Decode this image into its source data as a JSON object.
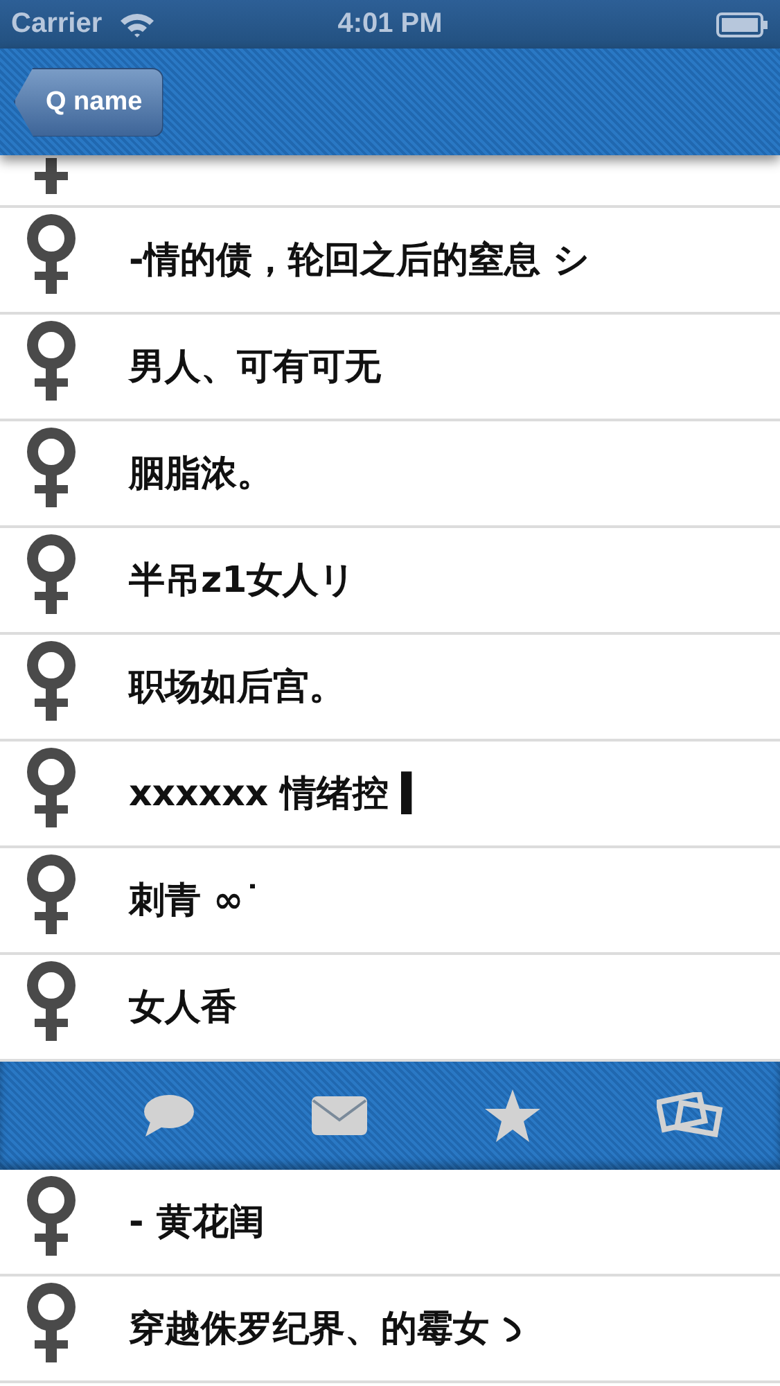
{
  "status_bar": {
    "carrier": "Carrier",
    "time": "4:01 PM"
  },
  "nav_bar": {
    "back_button": "Q name"
  },
  "list_top": [
    {
      "name": "-情的债，轮回之后的窒息 シ"
    },
    {
      "name": "男人、可有可无"
    },
    {
      "name": "胭脂浓。"
    },
    {
      "name": "半吊z1女人リ"
    },
    {
      "name": "职场如后宫。"
    },
    {
      "name": "xxxxxx 情绪控 ▍"
    },
    {
      "name": "刺青 ∞˙"
    },
    {
      "name": "女人香"
    }
  ],
  "tab_bar": {
    "tabs": [
      {
        "kind": "chat"
      },
      {
        "kind": "mail"
      },
      {
        "kind": "star"
      },
      {
        "kind": "photos"
      }
    ]
  },
  "list_bottom": [
    {
      "name": "- 黄花闺",
      "kind": "plain"
    },
    {
      "name": "穿越侏罗纪界、的霉女",
      "kind": "hooked"
    }
  ]
}
